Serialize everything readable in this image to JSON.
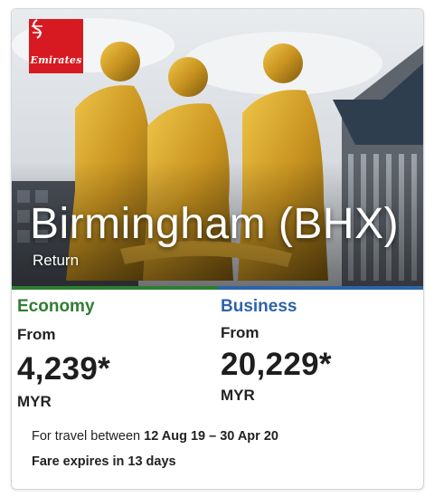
{
  "brand": {
    "name": "Emirates",
    "color": "#d71a21"
  },
  "destination": {
    "name": "Birmingham (BHX)",
    "trip_type": "Return"
  },
  "fares": [
    {
      "class": "Economy",
      "from_label": "From",
      "price": "4,239*",
      "currency": "MYR",
      "color": "#2f7d32"
    },
    {
      "class": "Business",
      "from_label": "From",
      "price": "20,229*",
      "currency": "MYR",
      "color": "#2f63a8"
    }
  ],
  "travel": {
    "prefix": "For travel between",
    "dates": "12 Aug 19 – 30 Apr 20"
  },
  "expiry": "Fare expires in 13 days"
}
